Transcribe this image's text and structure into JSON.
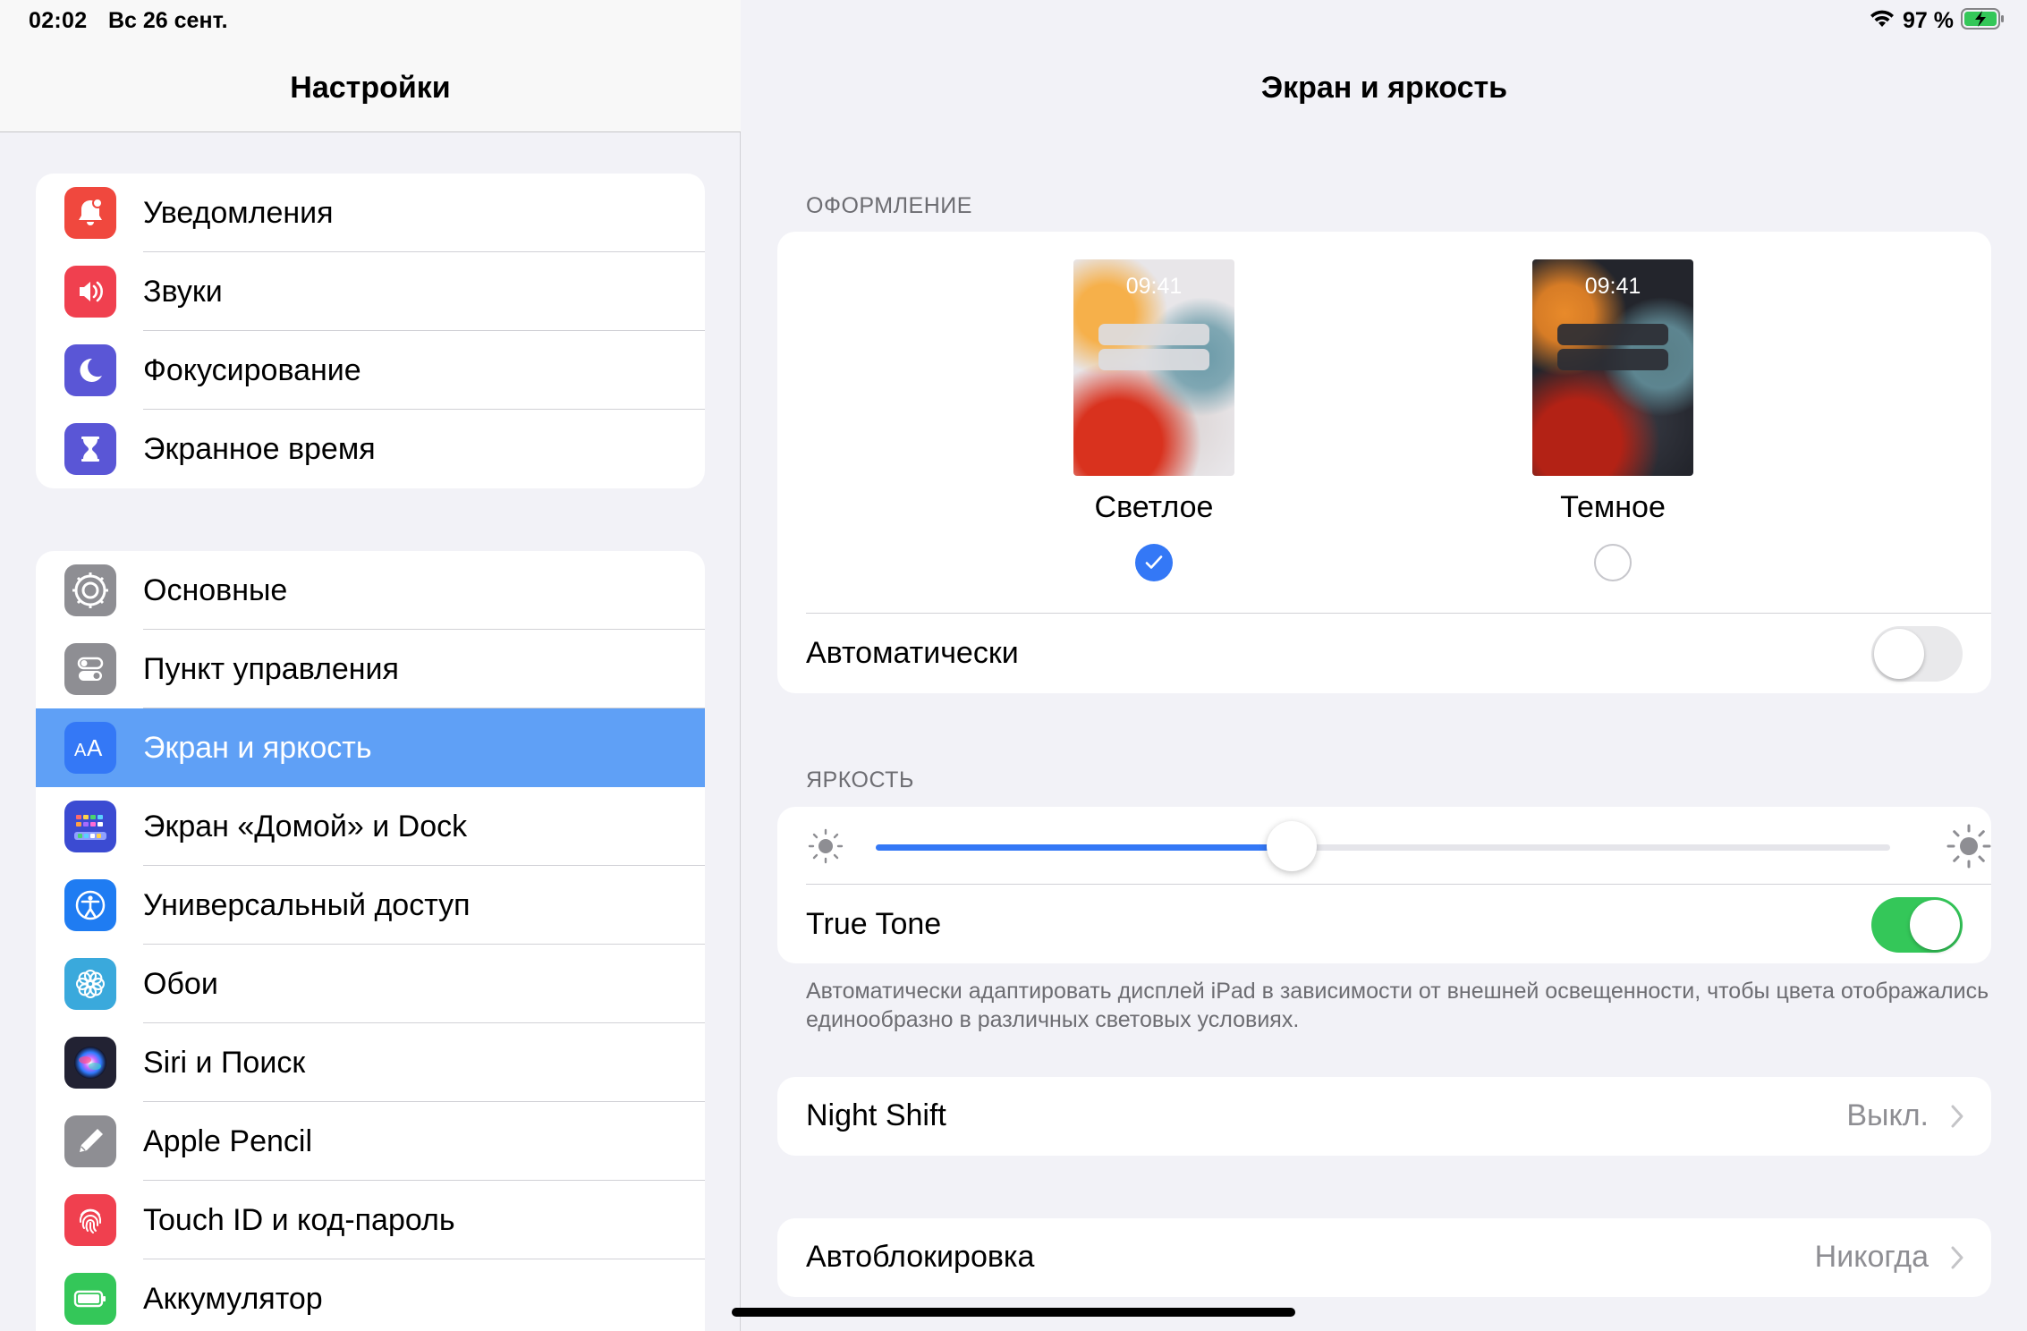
{
  "status_bar": {
    "time": "02:02",
    "date": "Вс 26 сент.",
    "battery": "97 %"
  },
  "sidebar": {
    "title": "Настройки",
    "group1": [
      {
        "label": "Уведомления",
        "icon": "notifications-icon",
        "color": "#f0483e"
      },
      {
        "label": "Звуки",
        "icon": "sounds-icon",
        "color": "#f0404f"
      },
      {
        "label": "Фокусирование",
        "icon": "moon-icon",
        "color": "#5a56d6"
      },
      {
        "label": "Экранное время",
        "icon": "hourglass-icon",
        "color": "#5a56d6"
      }
    ],
    "group2": [
      {
        "label": "Основные",
        "icon": "gear-icon",
        "color": "#8e8e93"
      },
      {
        "label": "Пункт управления",
        "icon": "toggles-icon",
        "color": "#8e8e93"
      },
      {
        "label": "Экран и яркость",
        "icon": "text-size-icon",
        "color": "#3478f6",
        "active": true
      },
      {
        "label": "Экран «Домой» и Dock",
        "icon": "home-grid-icon",
        "color": "#3b4bd2"
      },
      {
        "label": "Универсальный доступ",
        "icon": "accessibility-icon",
        "color": "#1f7cf2"
      },
      {
        "label": "Обои",
        "icon": "flower-icon",
        "color": "#3aa9dc"
      },
      {
        "label": "Siri и Поиск",
        "icon": "siri-icon",
        "color": "#222233"
      },
      {
        "label": "Apple Pencil",
        "icon": "pencil-icon",
        "color": "#8e8e93"
      },
      {
        "label": "Touch ID и код-пароль",
        "icon": "fingerprint-icon",
        "color": "#f0404f"
      },
      {
        "label": "Аккумулятор",
        "icon": "battery-icon",
        "color": "#34c759"
      }
    ]
  },
  "detail": {
    "title": "Экран и яркость",
    "appearance": {
      "section_label": "ОФОРМЛЕНИЕ",
      "light_label": "Светлое",
      "dark_label": "Темное",
      "thumb_time": "09:41",
      "selected": "light",
      "automatic_label": "Автоматически",
      "automatic_on": false
    },
    "brightness": {
      "section_label": "ЯРКОСТЬ",
      "level": 0.41,
      "true_tone_label": "True Tone",
      "true_tone_on": true,
      "footnote": "Автоматически адаптировать дисплей iPad в зависимости от внешней освещенности, чтобы цвета отображались единообразно в различных световых условиях."
    },
    "night_shift": {
      "label": "Night Shift",
      "value": "Выкл."
    },
    "auto_lock": {
      "label": "Автоблокировка",
      "value": "Никогда"
    }
  },
  "colors": {
    "accent": "#3478f6",
    "toggle_on": "#34c759",
    "selection": "#5fa0f6"
  }
}
